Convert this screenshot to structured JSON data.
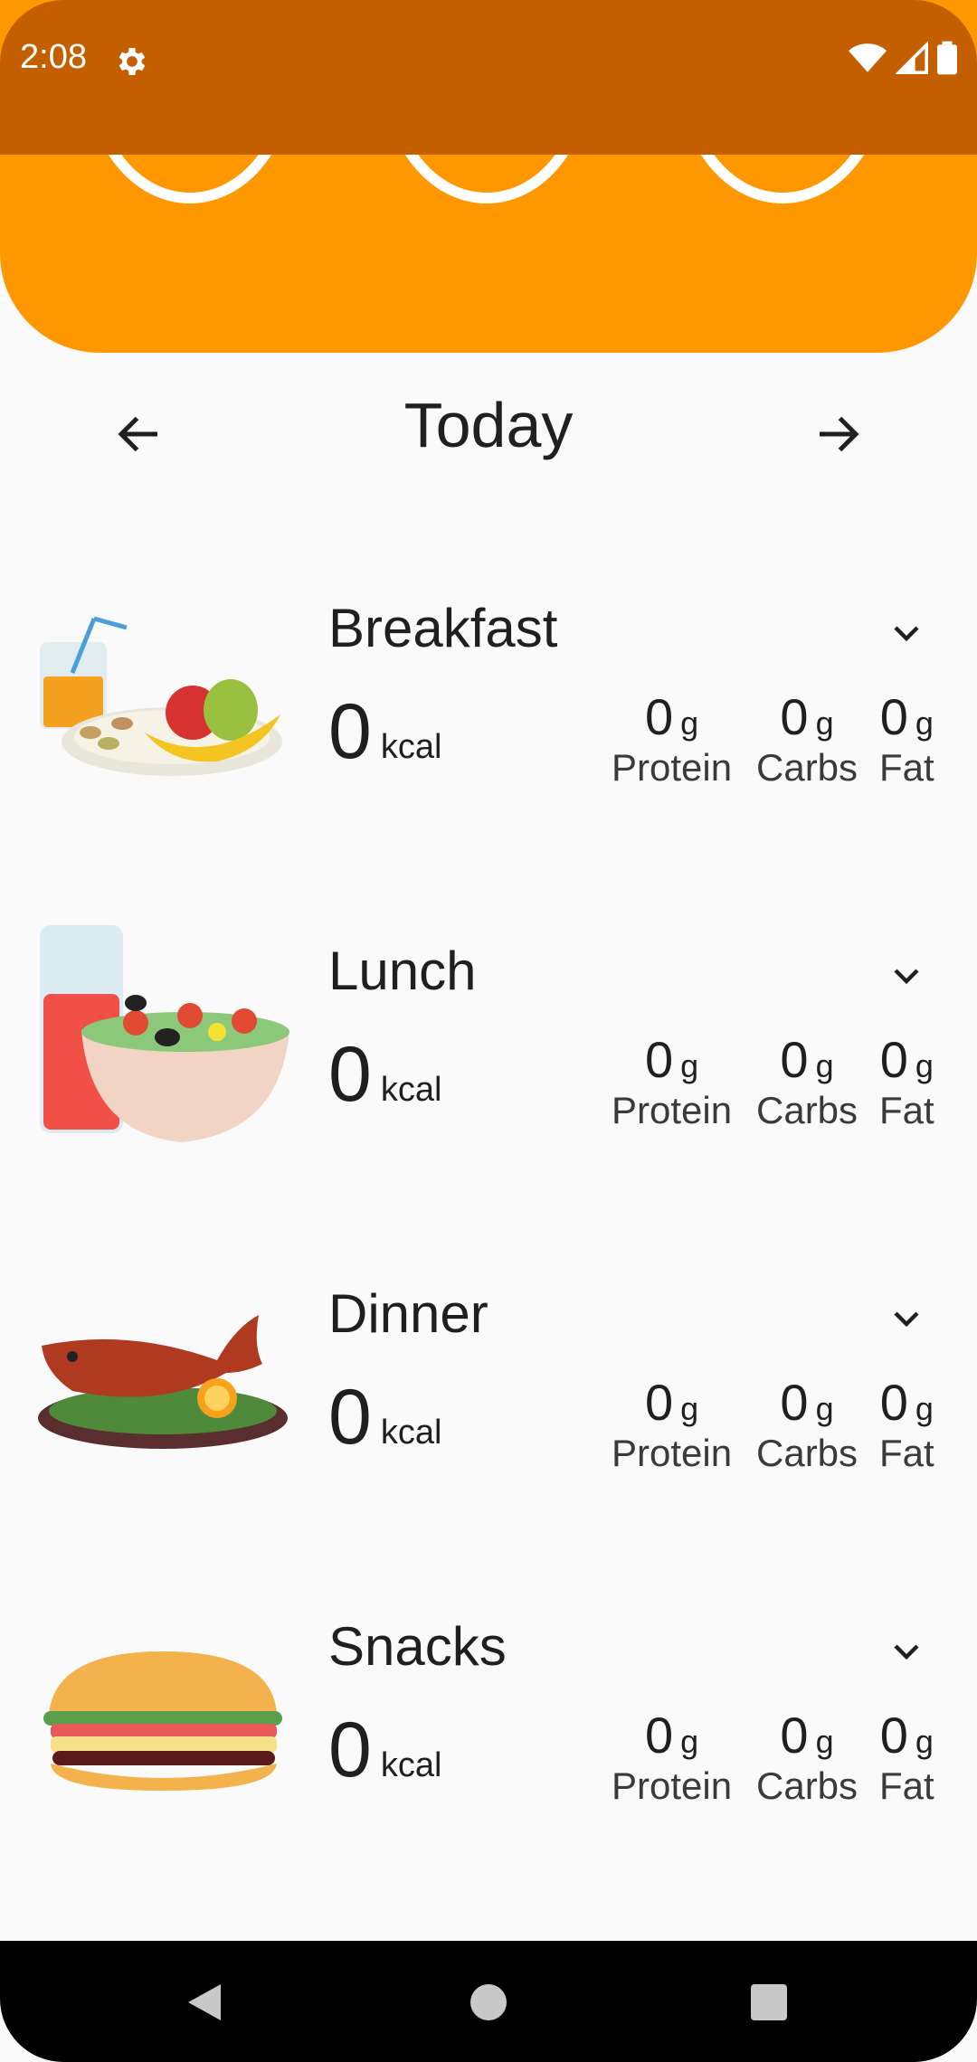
{
  "status_bar": {
    "time": "2:08",
    "icons": [
      "gear-icon",
      "wifi-icon",
      "signal-icon",
      "battery-icon"
    ]
  },
  "colors": {
    "header": "#ff9800",
    "status_bar": "#c45f00",
    "background": "#fafafa",
    "nav_bar": "#000000"
  },
  "date_nav": {
    "title": "Today",
    "prev_icon": "arrow-left-icon",
    "next_icon": "arrow-right-icon"
  },
  "meals": [
    {
      "name": "Breakfast",
      "kcal": "0",
      "kcal_unit": "kcal",
      "protein": "0",
      "carbs": "0",
      "fat": "0",
      "unit": "g",
      "protein_label": "Protein",
      "carbs_label": "Carbs",
      "fat_label": "Fat",
      "image": "breakfast-illustration"
    },
    {
      "name": "Lunch",
      "kcal": "0",
      "kcal_unit": "kcal",
      "protein": "0",
      "carbs": "0",
      "fat": "0",
      "unit": "g",
      "protein_label": "Protein",
      "carbs_label": "Carbs",
      "fat_label": "Fat",
      "image": "lunch-illustration"
    },
    {
      "name": "Dinner",
      "kcal": "0",
      "kcal_unit": "kcal",
      "protein": "0",
      "carbs": "0",
      "fat": "0",
      "unit": "g",
      "protein_label": "Protein",
      "carbs_label": "Carbs",
      "fat_label": "Fat",
      "image": "dinner-illustration"
    },
    {
      "name": "Snacks",
      "kcal": "0",
      "kcal_unit": "kcal",
      "protein": "0",
      "carbs": "0",
      "fat": "0",
      "unit": "g",
      "protein_label": "Protein",
      "carbs_label": "Carbs",
      "fat_label": "Fat",
      "image": "snacks-illustration"
    }
  ],
  "system_nav": [
    "back-icon",
    "home-icon",
    "recents-icon"
  ]
}
